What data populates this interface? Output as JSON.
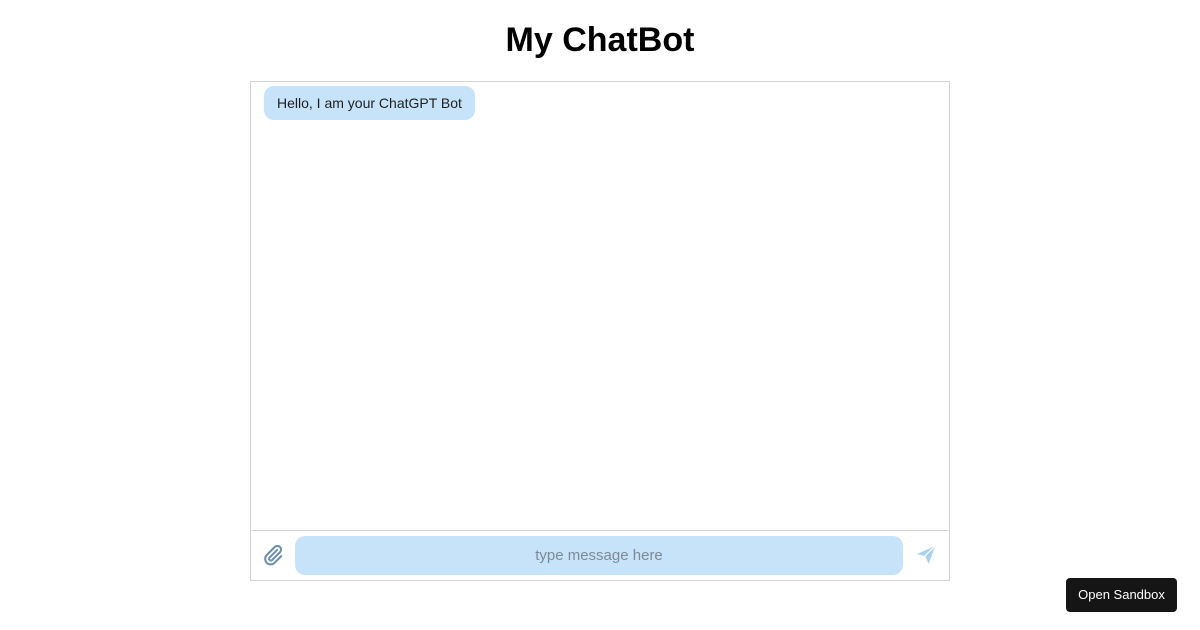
{
  "page": {
    "title": "My ChatBot"
  },
  "chat": {
    "messages": [
      {
        "sender": "bot",
        "text": "Hello, I am your ChatGPT Bot"
      }
    ],
    "input": {
      "placeholder": "type message here",
      "value": ""
    },
    "attach_icon": "paperclip-icon",
    "send_icon": "paper-plane-icon"
  },
  "sandbox_button": {
    "label": "Open Sandbox"
  },
  "colors": {
    "bubble_bg": "#c6e3fa",
    "input_bg": "#c6e3fa",
    "attach_icon": "#6a8fb5",
    "send_icon": "#a9d1f2",
    "sandbox_bg": "#151515",
    "border": "#d4d4d4"
  }
}
